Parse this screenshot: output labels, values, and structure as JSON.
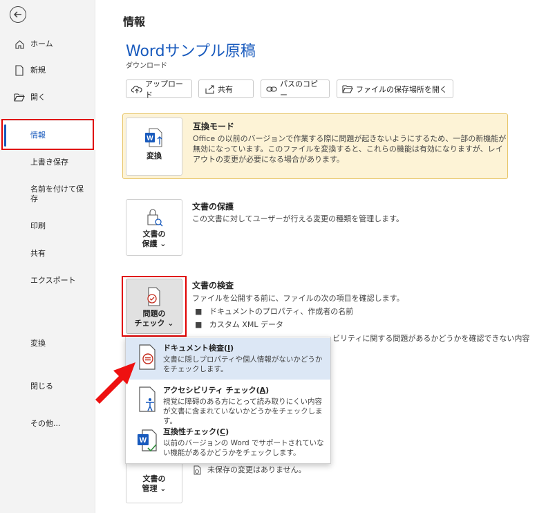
{
  "sidebar": {
    "items": [
      {
        "label": "ホーム",
        "icon": "home-icon"
      },
      {
        "label": "新規",
        "icon": "new-document-icon"
      },
      {
        "label": "開く",
        "icon": "folder-open-icon"
      },
      {
        "label": "情報"
      },
      {
        "label": "上書き保存"
      },
      {
        "label": "名前を付けて保存"
      },
      {
        "label": "印刷"
      },
      {
        "label": "共有"
      },
      {
        "label": "エクスポート"
      },
      {
        "label": "変換"
      },
      {
        "label": "閉じる"
      },
      {
        "label": "その他..."
      }
    ]
  },
  "main": {
    "page_title": "情報",
    "doc_title": "Wordサンプル原稿",
    "doc_subtitle": "ダウンロード",
    "toolbar": {
      "upload": "アップロード",
      "share": "共有",
      "copy_path": "パスのコピー",
      "open_location": "ファイルの保存場所を開く"
    },
    "compat": {
      "button": "変換",
      "title": "互換モード",
      "desc": "Office の以前のバージョンで作業する際に問題が起きないようにするため、一部の新機能が無効になっています。このファイルを変換すると、これらの機能は有効になりますが、レイアウトの変更が必要になる場合があります。"
    },
    "protect": {
      "button_line1": "文書の",
      "button_line2": "保護 ⌄",
      "title": "文書の保護",
      "desc": "この文書に対してユーザーが行える変更の種類を管理します。"
    },
    "inspect": {
      "button_line1": "問題の",
      "button_line2": "チェック ⌄",
      "title": "文書の検査",
      "desc": "ファイルを公開する前に、ファイルの次の項目を確認します。",
      "bullets": [
        "ドキュメントのプロパティ、作成者の名前",
        "カスタム XML データ"
      ],
      "partial_line": "ビリティに関する問題があるかどうかを確認できない内容"
    },
    "manage": {
      "button_line1": "文書の",
      "button_line2": "管理 ⌄",
      "status": "未保存の変更はありません。"
    },
    "dropdown": [
      {
        "title": "ドキュメント検査",
        "key": "(I)",
        "desc": "文書に隠しプロパティや個人情報がないかどうかをチェックします。"
      },
      {
        "title": "アクセシビリティ チェック",
        "key": "(A)",
        "desc": "視覚に障碍のある方にとって読み取りにくい内容が文書に含まれていないかどうかをチェックします。"
      },
      {
        "title": "互換性チェック",
        "key": "(C)",
        "desc": "以前のバージョンの Word でサポートされていない機能があるかどうかをチェックします。"
      }
    ]
  },
  "colors": {
    "accent": "#185abd",
    "highlight_red": "#e00000",
    "warning_bg": "#fdf3d6",
    "menu_highlight": "#dce7f5"
  }
}
